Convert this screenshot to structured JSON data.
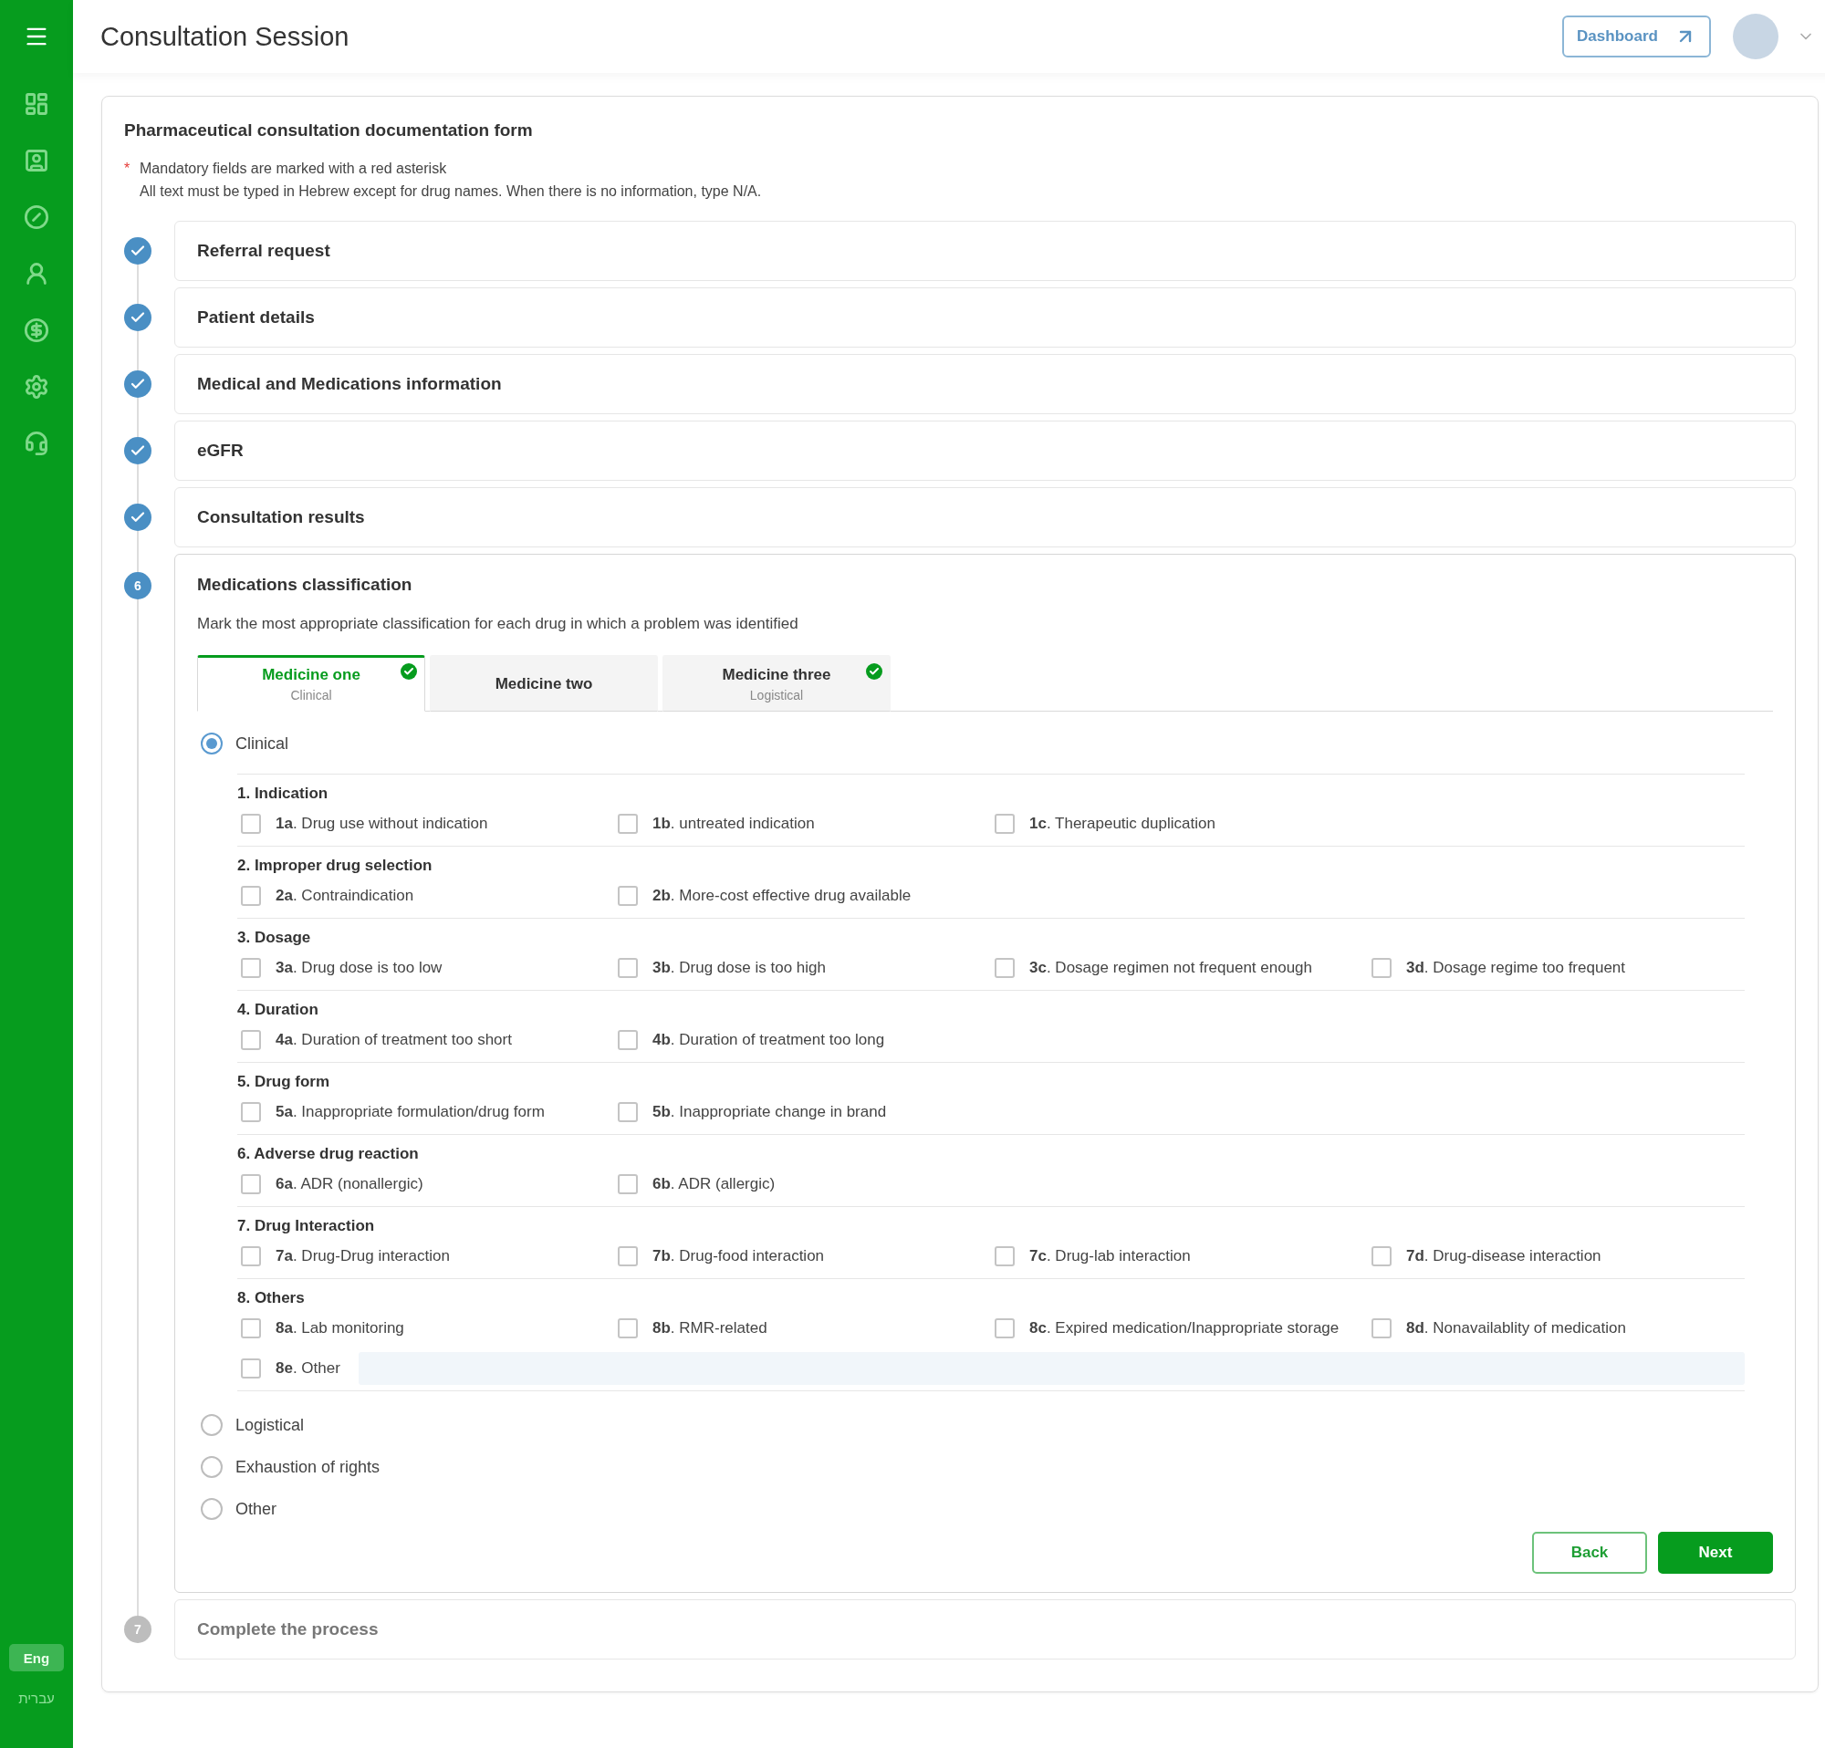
{
  "header": {
    "title": "Consultation Session",
    "dashboard_button": "Dashboard"
  },
  "sidebar": {
    "languages": [
      {
        "label": "Eng",
        "selected": true
      },
      {
        "label": "עברית",
        "selected": false
      }
    ]
  },
  "form": {
    "title": "Pharmaceutical consultation documentation form",
    "mandatory_mark": "*",
    "mandatory_note": "Mandatory fields are marked with a red asterisk",
    "instruction": "All text must be typed in Hebrew except for drug names. When there is no information, type N/A."
  },
  "steps": [
    {
      "title": "Referral request",
      "completed": true,
      "active": false
    },
    {
      "title": "Patient details",
      "completed": true,
      "active": false
    },
    {
      "title": "Medical and Medications information",
      "completed": true,
      "active": false
    },
    {
      "title": "eGFR",
      "completed": true,
      "active": false
    },
    {
      "title": "Consultation results",
      "completed": true,
      "active": false
    },
    {
      "number": "6",
      "title": "Medications classification",
      "completed": false,
      "active": true
    },
    {
      "number": "7",
      "title": "Complete the process",
      "completed": false,
      "active": false
    }
  ],
  "classification": {
    "subtitle": "Mark the most appropriate classification for each drug in which a problem was identified",
    "tabs": [
      {
        "label": "Medicine one",
        "sublabel": "Clinical",
        "selected": true,
        "completed": true
      },
      {
        "label": "Medicine two",
        "selected": false,
        "completed": false
      },
      {
        "label": "Medicine three",
        "sublabel": "Logistical",
        "selected": false,
        "completed": true
      }
    ],
    "categories": [
      {
        "label": "Clinical",
        "selected": true,
        "groups": [
          {
            "title": "1. Indication",
            "options": [
              {
                "label": "**1a**. Drug use without indication",
                "checked": false
              },
              {
                "label": "**1b**. untreated indication",
                "checked": false
              },
              {
                "label": "**1c**. Therapeutic duplication",
                "checked": false
              }
            ]
          },
          {
            "title": "2. Improper drug selection",
            "options": [
              {
                "label": "**2a**. Contraindication",
                "checked": false
              },
              {
                "label": "**2b**. More-cost effective drug available",
                "checked": false
              }
            ]
          },
          {
            "title": "3. Dosage",
            "options": [
              {
                "label": "**3a**. Drug dose is too low",
                "checked": false
              },
              {
                "label": "**3b**. Drug dose is too high",
                "checked": false
              },
              {
                "label": "**3c**. Dosage regimen not frequent enough",
                "checked": false
              },
              {
                "label": "**3d**. Dosage regime too frequent",
                "checked": false
              }
            ]
          },
          {
            "title": "4. Duration",
            "options": [
              {
                "label": "**4a**. Duration of treatment too short",
                "checked": false
              },
              {
                "label": "**4b**. Duration of treatment too long",
                "checked": false
              }
            ]
          },
          {
            "title": "5. Drug form",
            "options": [
              {
                "label": "**5a**. Inappropriate formulation/drug form",
                "checked": false
              },
              {
                "label": "**5b**. Inappropriate change in brand",
                "checked": false
              }
            ]
          },
          {
            "title": "6. Adverse drug reaction",
            "options": [
              {
                "label": "**6a**. ADR (nonallergic)",
                "checked": false
              },
              {
                "label": "**6b**. ADR (allergic)",
                "checked": false
              }
            ]
          },
          {
            "title": "7. Drug Interaction",
            "options": [
              {
                "label": "**7a**. Drug-Drug interaction",
                "checked": false
              },
              {
                "label": "**7b**. Drug-food interaction",
                "checked": false
              },
              {
                "label": "**7c**. Drug-lab interaction",
                "checked": false
              },
              {
                "label": "**7d**. Drug-disease interaction",
                "checked": false
              }
            ]
          },
          {
            "title": "8. Others",
            "options": [
              {
                "label": "**8a**. Lab monitoring",
                "checked": false
              },
              {
                "label": "**8b**. RMR-related",
                "checked": false
              },
              {
                "label": "**8c**. Expired medication/Inappropriate storage",
                "checked": false
              },
              {
                "label": "**8d**. Nonavailablity of medication",
                "checked": false
              }
            ],
            "other_option": {
              "label": "**8e**. Other",
              "checked": false
            }
          }
        ]
      },
      {
        "label": "Logistical",
        "selected": false
      },
      {
        "label": "Exhaustion of rights",
        "selected": false
      },
      {
        "label": "Other",
        "selected": false
      }
    ],
    "back_button": "Back",
    "next_button": "Next"
  }
}
